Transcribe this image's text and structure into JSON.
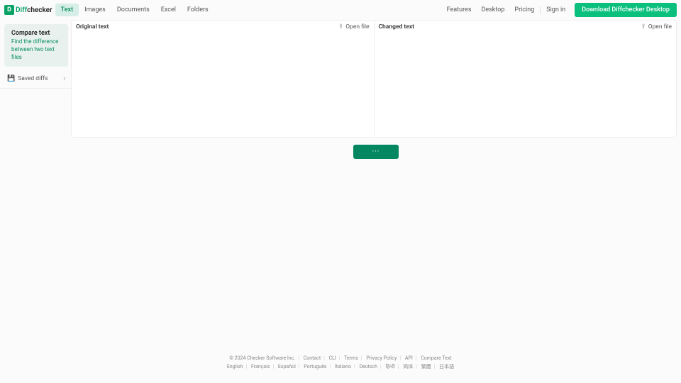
{
  "logo": {
    "icon": "D",
    "part1": "Diff",
    "part2": "checker"
  },
  "tabs": {
    "text": "Text",
    "images": "Images",
    "documents": "Documents",
    "excel": "Excel",
    "folders": "Folders"
  },
  "nav": {
    "features": "Features",
    "desktop": "Desktop",
    "pricing": "Pricing",
    "signin": "Sign in",
    "download": "Download Diffchecker Desktop"
  },
  "sidebar": {
    "card_title": "Compare text",
    "card_desc1": "Find the difference",
    "card_desc2": "between two text files",
    "saved": "Saved diffs",
    "saved_icon": "💾",
    "chevron": "‹"
  },
  "panes": {
    "left_title": "Original text",
    "right_title": "Changed text",
    "open_file": "Open file"
  },
  "find_btn": "···",
  "footer": {
    "row1": {
      "copyright": "© 2024 Checker Software Inc.",
      "contact": "Contact",
      "cli": "CLI",
      "terms": "Terms",
      "privacy": "Privacy Policy",
      "api": "API",
      "compare": "Compare Text"
    },
    "row2": {
      "english": "English",
      "francais": "Français",
      "espanol": "Español",
      "portugues": "Português",
      "italiano": "Italiano",
      "deutsch": "Deutsch",
      "hindi": "हिन्दी",
      "zhs": "简体",
      "zht": "繁體",
      "ja": "日本語"
    }
  }
}
